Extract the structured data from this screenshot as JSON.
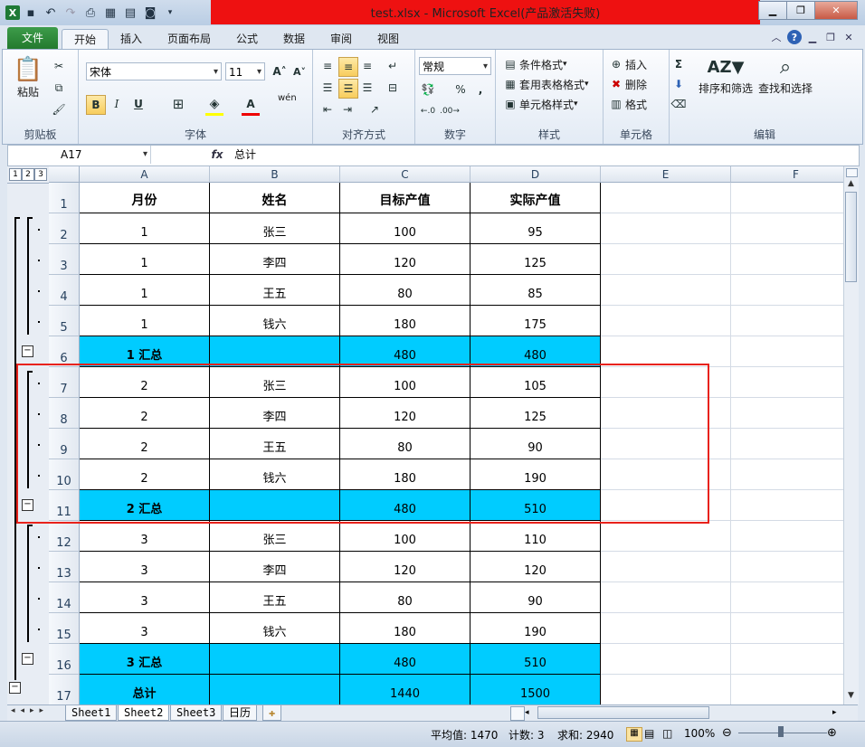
{
  "window": {
    "title": "test.xlsx - Microsoft Excel(产品激活失败)"
  },
  "tabs": [
    "文件",
    "开始",
    "插入",
    "页面布局",
    "公式",
    "数据",
    "审阅",
    "视图"
  ],
  "ribbon": {
    "clipboard": {
      "label": "剪贴板",
      "paste": "粘贴"
    },
    "font": {
      "label": "字体",
      "font_name": "宋体",
      "font_size": "11",
      "bold": "B",
      "italic": "I",
      "underline": "U",
      "wen": "wén"
    },
    "alignment": {
      "label": "对齐方式"
    },
    "number": {
      "label": "数字",
      "format": "常规",
      "percent": "%",
      "comma": ",",
      "dec_inc": "+.0\n.00",
      "dec_dec": ".00\n+.0"
    },
    "styles": {
      "label": "样式",
      "conditional": "条件格式",
      "table": "套用表格格式",
      "cell": "单元格样式"
    },
    "cells": {
      "label": "单元格",
      "insert": "插入",
      "delete": "删除",
      "format": "格式"
    },
    "editing": {
      "label": "编辑",
      "sort": "排序和筛选",
      "find": "查找和选择",
      "sigma": "Σ"
    }
  },
  "formula_bar": {
    "name_box": "A17",
    "fx": "fx",
    "content": "总计"
  },
  "outline": {
    "levels": [
      "1",
      "2",
      "3"
    ]
  },
  "columns": [
    "A",
    "B",
    "C",
    "D",
    "E",
    "F"
  ],
  "rows": [
    {
      "n": "1",
      "cells": [
        "月份",
        "姓名",
        "目标产值",
        "实际产值"
      ],
      "type": "header"
    },
    {
      "n": "2",
      "cells": [
        "1",
        "张三",
        "100",
        "95"
      ],
      "type": "data"
    },
    {
      "n": "3",
      "cells": [
        "1",
        "李四",
        "120",
        "125"
      ],
      "type": "data"
    },
    {
      "n": "4",
      "cells": [
        "1",
        "王五",
        "80",
        "85"
      ],
      "type": "data"
    },
    {
      "n": "5",
      "cells": [
        "1",
        "钱六",
        "180",
        "175"
      ],
      "type": "data"
    },
    {
      "n": "6",
      "cells": [
        "1 汇总",
        "",
        "480",
        "480"
      ],
      "type": "sum"
    },
    {
      "n": "7",
      "cells": [
        "2",
        "张三",
        "100",
        "105"
      ],
      "type": "data"
    },
    {
      "n": "8",
      "cells": [
        "2",
        "李四",
        "120",
        "125"
      ],
      "type": "data"
    },
    {
      "n": "9",
      "cells": [
        "2",
        "王五",
        "80",
        "90"
      ],
      "type": "data"
    },
    {
      "n": "10",
      "cells": [
        "2",
        "钱六",
        "180",
        "190"
      ],
      "type": "data"
    },
    {
      "n": "11",
      "cells": [
        "2 汇总",
        "",
        "480",
        "510"
      ],
      "type": "sum"
    },
    {
      "n": "12",
      "cells": [
        "3",
        "张三",
        "100",
        "110"
      ],
      "type": "data"
    },
    {
      "n": "13",
      "cells": [
        "3",
        "李四",
        "120",
        "120"
      ],
      "type": "data"
    },
    {
      "n": "14",
      "cells": [
        "3",
        "王五",
        "80",
        "90"
      ],
      "type": "data"
    },
    {
      "n": "15",
      "cells": [
        "3",
        "钱六",
        "180",
        "190"
      ],
      "type": "data"
    },
    {
      "n": "16",
      "cells": [
        "3 汇总",
        "",
        "480",
        "510"
      ],
      "type": "sum"
    },
    {
      "n": "17",
      "cells": [
        "总计",
        "",
        "1440",
        "1500"
      ],
      "type": "sum"
    }
  ],
  "sheets": [
    "Sheet1",
    "Sheet2",
    "Sheet3",
    "日历"
  ],
  "active_sheet": "Sheet2",
  "status": {
    "average": "平均值: 1470",
    "count": "计数: 3",
    "sum": "求和: 2940",
    "zoom": "100%"
  },
  "colors": {
    "summary_fill": "#00ccff",
    "highlight_box": "#e8221b",
    "title_bar": "#ee1111"
  }
}
